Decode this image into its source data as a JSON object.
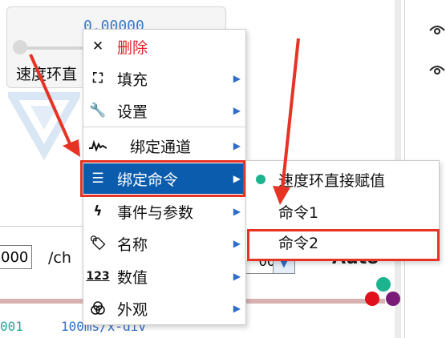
{
  "slider": {
    "value": "0.00000",
    "label": "速度环直"
  },
  "bottom": {
    "rate_value": "000",
    "rate_unit": "/ch",
    "left_status": "001",
    "time_div": "100ms/x-div",
    "num_value": "00",
    "spin_icon": "chevron-down-icon",
    "auto_label": "Auto"
  },
  "channel_dots": {
    "colors": [
      "#1db38f",
      "#e0101c",
      "#7a1b7a"
    ]
  },
  "context_menu": {
    "items": [
      {
        "label": "删除",
        "icon": "close-icon",
        "color": "#e0202c",
        "has_submenu": false
      },
      {
        "label": "填充",
        "icon": "fullscreen-icon",
        "has_submenu": true
      },
      {
        "label": "设置",
        "icon": "wrench-icon",
        "has_submenu": true
      },
      {
        "label": "绑定通道",
        "icon": "waveform-icon",
        "has_submenu": true
      },
      {
        "label": "绑定命令",
        "icon": "list-icon",
        "has_submenu": true,
        "selected": true
      },
      {
        "label": "事件与参数",
        "icon": "lightning-icon",
        "has_submenu": true
      },
      {
        "label": "名称",
        "icon": "tag-icon",
        "has_submenu": true
      },
      {
        "label": "数值",
        "icon": "numbers-icon",
        "has_submenu": true
      },
      {
        "label": "外观",
        "icon": "palette-icon",
        "has_submenu": true
      }
    ],
    "arrow": "▶",
    "selected_color": "#0b5cad"
  },
  "submenu": {
    "items": [
      {
        "label": "速度环直接赋值",
        "checked": true
      },
      {
        "label": "命令1",
        "checked": false
      },
      {
        "label": "命令2",
        "checked": false
      }
    ],
    "check_color": "#1db38f"
  },
  "annotation": {
    "color": "#e63324"
  }
}
